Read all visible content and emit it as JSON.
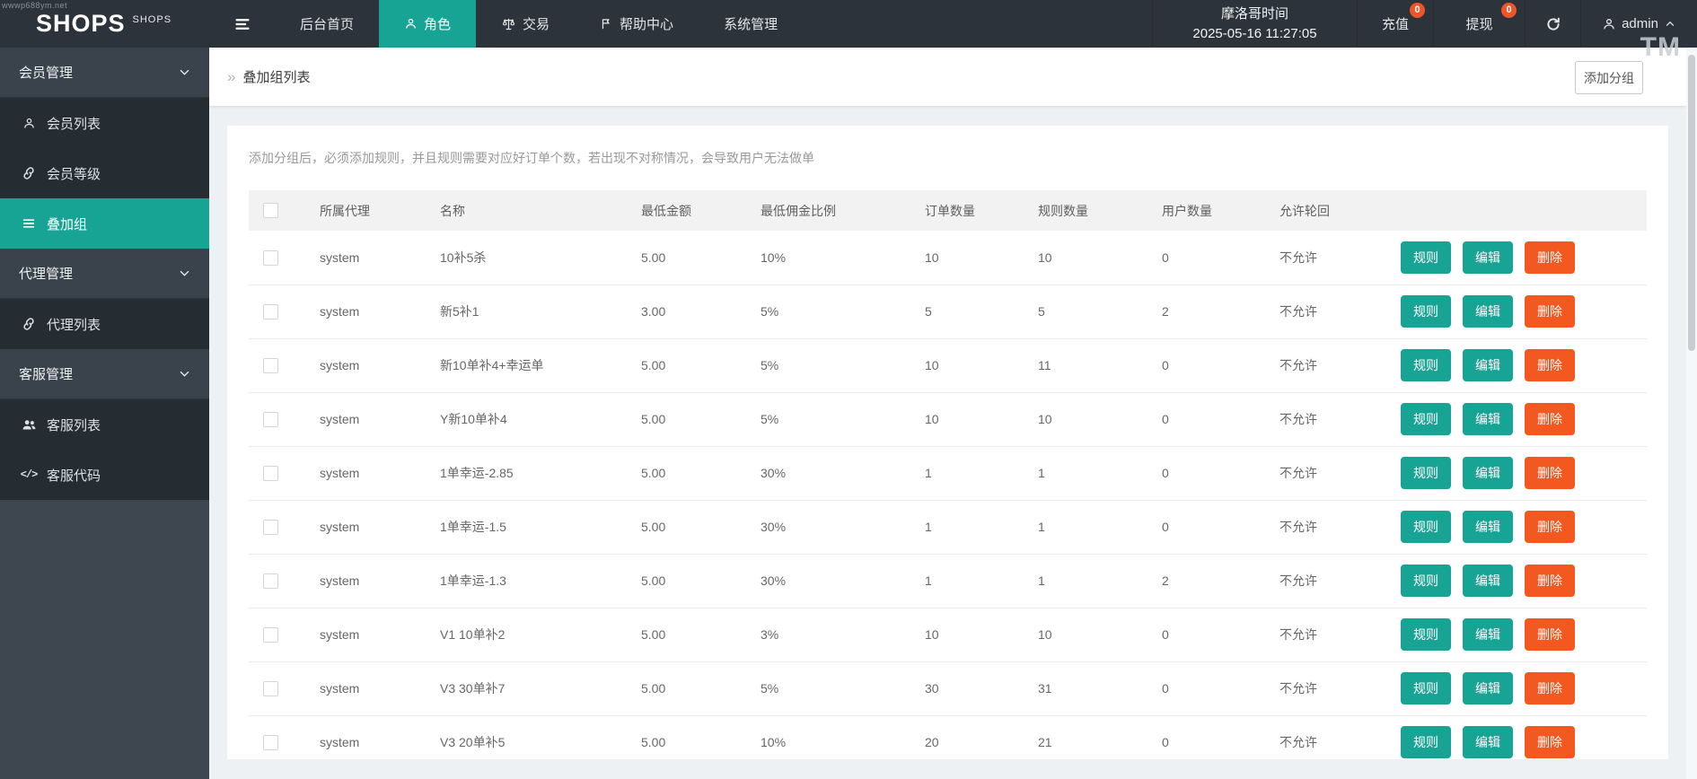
{
  "watermarks": {
    "top_left": "wwwp688ym.net",
    "tm": "TM"
  },
  "topbar": {
    "logo": "SHOPS",
    "logo_small": "SHOPS",
    "nav": [
      {
        "key": "home",
        "label": "后台首页",
        "icon": "",
        "active": false
      },
      {
        "key": "role",
        "label": "角色",
        "icon": "user",
        "active": true
      },
      {
        "key": "trade",
        "label": "交易",
        "icon": "scales",
        "active": false
      },
      {
        "key": "help",
        "label": "帮助中心",
        "icon": "flag",
        "active": false
      },
      {
        "key": "system",
        "label": "系统管理",
        "icon": "",
        "active": false
      }
    ],
    "timezone_label": "摩洛哥时间",
    "time": "2025-05-16 11:27:05",
    "recharge": {
      "label": "充值",
      "badge": "0"
    },
    "withdraw": {
      "label": "提现",
      "badge": "0"
    },
    "user": "admin"
  },
  "sidebar": {
    "sections": [
      {
        "key": "member-mgmt",
        "title": "会员管理",
        "items": [
          {
            "key": "member-list",
            "label": "会员列表",
            "icon": "user",
            "active": false
          },
          {
            "key": "member-level",
            "label": "会员等级",
            "icon": "link",
            "active": false
          },
          {
            "key": "stack-group",
            "label": "叠加组",
            "icon": "list",
            "active": true
          }
        ]
      },
      {
        "key": "agent-mgmt",
        "title": "代理管理",
        "items": [
          {
            "key": "agent-list",
            "label": "代理列表",
            "icon": "link",
            "active": false
          }
        ]
      },
      {
        "key": "service-mgmt",
        "title": "客服管理",
        "items": [
          {
            "key": "service-list",
            "label": "客服列表",
            "icon": "users",
            "active": false
          },
          {
            "key": "service-code",
            "label": "客服代码",
            "icon": "code",
            "active": false
          }
        ]
      }
    ]
  },
  "breadcrumb": {
    "prefix": "»",
    "title": "叠加组列表",
    "add_button": "添加分组"
  },
  "main": {
    "note": "添加分组后，必须添加规则，并且规则需要对应好订单个数，若出现不对称情况，会导致用户无法做单",
    "table": {
      "headers": [
        "所属代理",
        "名称",
        "最低金额",
        "最低佣金比例",
        "订单数量",
        "规则数量",
        "用户数量",
        "允许轮回"
      ],
      "action_labels": {
        "rule": "规则",
        "edit": "编辑",
        "delete": "删除"
      },
      "rows": [
        {
          "agent": "system",
          "name": "10补5杀",
          "min_amount": "5.00",
          "min_commission": "10%",
          "orders": "10",
          "rules": "10",
          "users": "0",
          "loop": "不允许"
        },
        {
          "agent": "system",
          "name": "新5补1",
          "min_amount": "3.00",
          "min_commission": "5%",
          "orders": "5",
          "rules": "5",
          "users": "2",
          "loop": "不允许"
        },
        {
          "agent": "system",
          "name": "新10单补4+幸运单",
          "min_amount": "5.00",
          "min_commission": "5%",
          "orders": "10",
          "rules": "11",
          "users": "0",
          "loop": "不允许"
        },
        {
          "agent": "system",
          "name": "Y新10单补4",
          "min_amount": "5.00",
          "min_commission": "5%",
          "orders": "10",
          "rules": "10",
          "users": "0",
          "loop": "不允许"
        },
        {
          "agent": "system",
          "name": "1单幸运-2.85",
          "min_amount": "5.00",
          "min_commission": "30%",
          "orders": "1",
          "rules": "1",
          "users": "0",
          "loop": "不允许"
        },
        {
          "agent": "system",
          "name": "1单幸运-1.5",
          "min_amount": "5.00",
          "min_commission": "30%",
          "orders": "1",
          "rules": "1",
          "users": "0",
          "loop": "不允许"
        },
        {
          "agent": "system",
          "name": "1单幸运-1.3",
          "min_amount": "5.00",
          "min_commission": "30%",
          "orders": "1",
          "rules": "1",
          "users": "2",
          "loop": "不允许"
        },
        {
          "agent": "system",
          "name": "V1 10单补2",
          "min_amount": "5.00",
          "min_commission": "3%",
          "orders": "10",
          "rules": "10",
          "users": "0",
          "loop": "不允许"
        },
        {
          "agent": "system",
          "name": "V3 30单补7",
          "min_amount": "5.00",
          "min_commission": "5%",
          "orders": "30",
          "rules": "31",
          "users": "0",
          "loop": "不允许"
        },
        {
          "agent": "system",
          "name": "V3 20单补5",
          "min_amount": "5.00",
          "min_commission": "10%",
          "orders": "20",
          "rules": "21",
          "users": "0",
          "loop": "不允许"
        }
      ]
    }
  },
  "colors": {
    "accent": "#18a494",
    "danger": "#f25820",
    "badge": "#f0552a"
  }
}
